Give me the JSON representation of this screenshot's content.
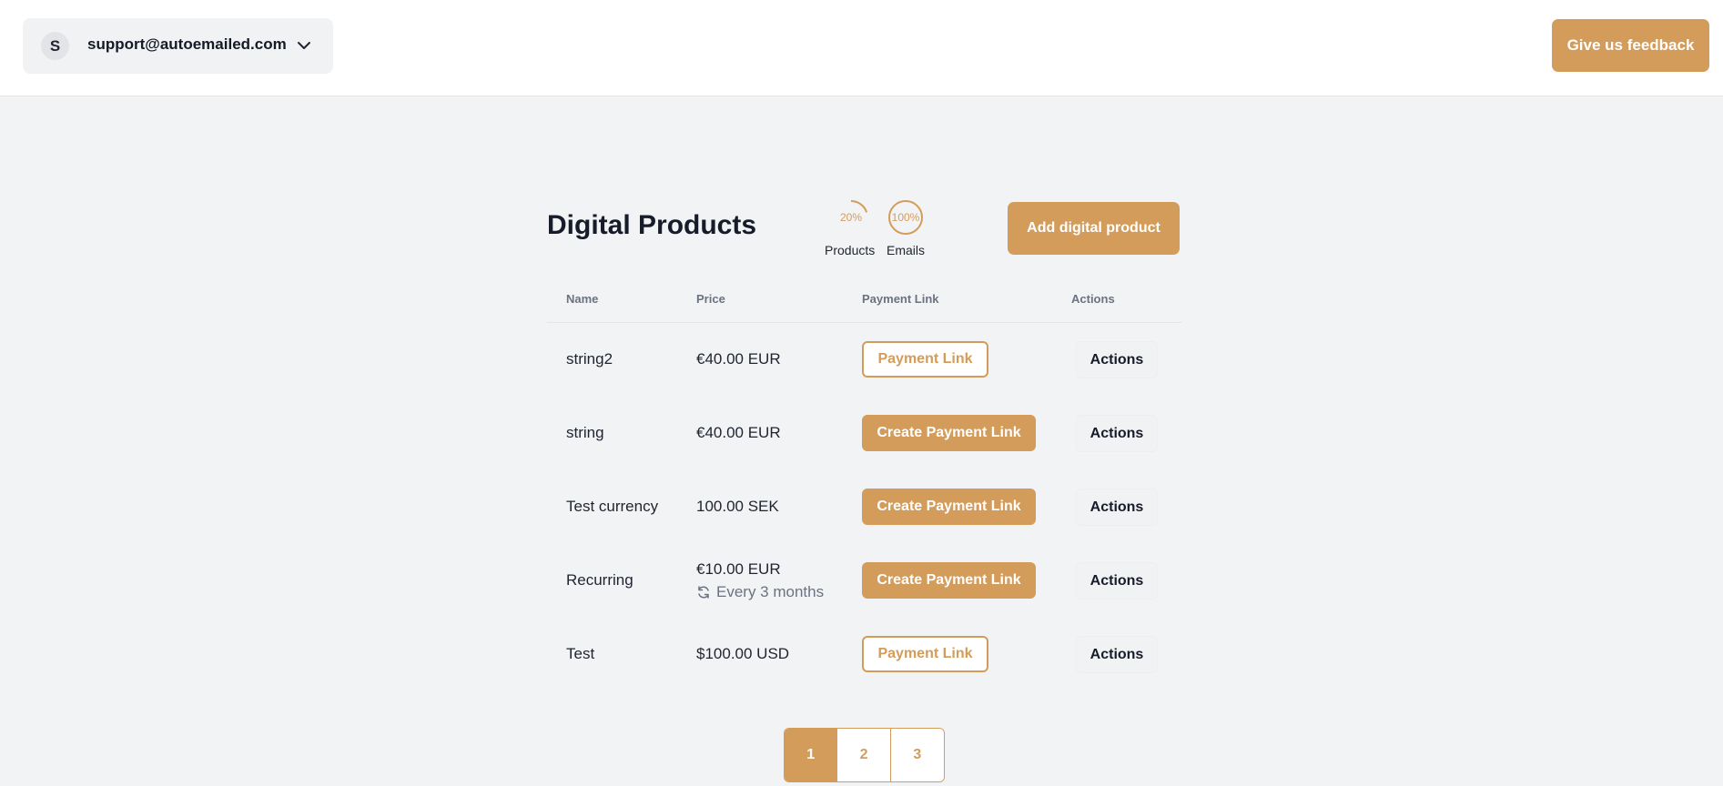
{
  "header": {
    "avatar_initial": "S",
    "account_email": "support@autoemailed.com",
    "feedback_label": "Give us feedback"
  },
  "page": {
    "title": "Digital Products",
    "add_label": "Add digital product"
  },
  "usage": [
    {
      "label": "20%",
      "caption": "Products",
      "percent": 20
    },
    {
      "label": "100%",
      "caption": "Emails",
      "percent": 100
    }
  ],
  "table": {
    "columns": [
      "Name",
      "Price",
      "Payment Link",
      "Actions"
    ],
    "rows": [
      {
        "name": "string2",
        "price": "€40.00 EUR",
        "recurrence": "",
        "payment_link": "Payment Link",
        "actions": "Actions"
      },
      {
        "name": "string",
        "price": "€40.00 EUR",
        "recurrence": "",
        "payment_link": "Create Payment Link",
        "actions": "Actions"
      },
      {
        "name": "Test currency",
        "price": "100.00 SEK",
        "recurrence": "",
        "payment_link": "Create Payment Link",
        "actions": "Actions"
      },
      {
        "name": "Recurring",
        "price": "€10.00 EUR",
        "recurrence": "Every 3 months",
        "payment_link": "Create Payment Link",
        "actions": "Actions"
      },
      {
        "name": "Test",
        "price": "$100.00 USD",
        "recurrence": "",
        "payment_link": "Payment Link",
        "actions": "Actions"
      }
    ]
  },
  "pagination": {
    "pages": [
      "1",
      "2",
      "3"
    ],
    "current": "1"
  },
  "colors": {
    "accent": "#d49c5a",
    "background": "#f2f3f5"
  }
}
